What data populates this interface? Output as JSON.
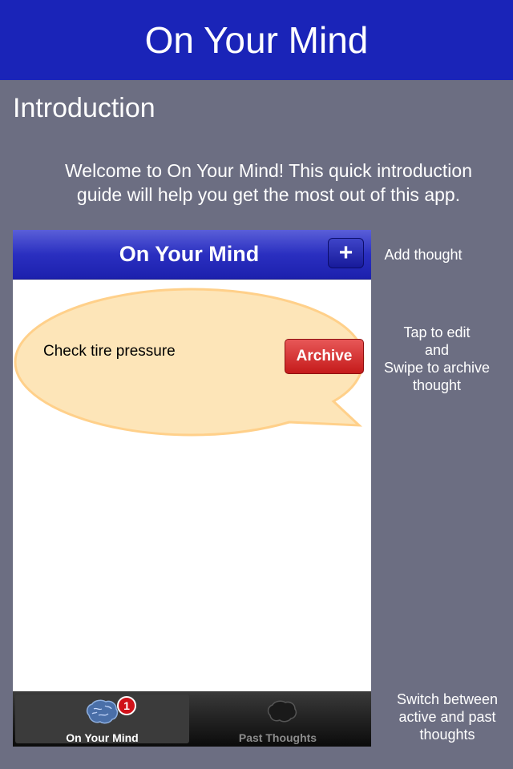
{
  "header": {
    "title": "On Your Mind"
  },
  "intro": {
    "title": "Introduction",
    "welcome_line1": "Welcome to On Your Mind! This quick introduction",
    "welcome_line2": "guide will help you get the most out of this app."
  },
  "phone": {
    "nav_title": "On Your Mind",
    "add_button": "+",
    "thought": "Check tire pressure",
    "archive_label": "Archive",
    "tabs": [
      {
        "label": "On Your Mind",
        "badge": "1",
        "icon": "brain-icon",
        "active": true
      },
      {
        "label": "Past Thoughts",
        "icon": "brain-outline-icon",
        "active": false
      }
    ]
  },
  "annotations": {
    "add": "Add thought",
    "edit_line1": "Tap to edit",
    "edit_line2": "and",
    "edit_line3": "Swipe to archive",
    "edit_line4": "thought",
    "switch_line1": "Switch between",
    "switch_line2": "active and past",
    "switch_line3": "thoughts"
  },
  "colors": {
    "header_bg": "#1a24b8",
    "page_bg": "#6c6e82",
    "bubble_fill": "#fde5b8",
    "bubble_stroke": "#ffd08a",
    "archive_red": "#c51b1b"
  }
}
